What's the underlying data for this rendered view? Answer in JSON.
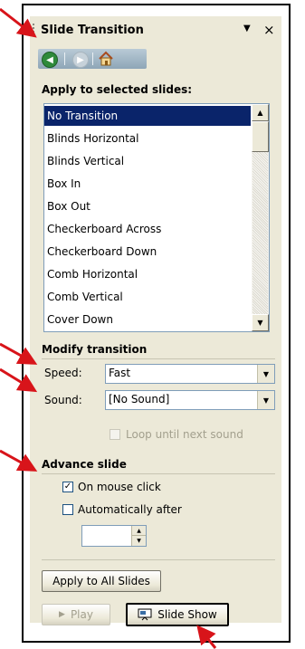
{
  "pane": {
    "title": "Slide Transition",
    "menu_glyph": "▼",
    "close_glyph": "×",
    "nav": {
      "back": "back-arrow-icon",
      "forward": "forward-arrow-icon",
      "home": "home-icon"
    }
  },
  "apply_section": {
    "title": "Apply to selected slides:",
    "selected_index": 0,
    "items": [
      "No Transition",
      "Blinds Horizontal",
      "Blinds Vertical",
      "Box In",
      "Box Out",
      "Checkerboard Across",
      "Checkerboard Down",
      "Comb Horizontal",
      "Comb Vertical",
      "Cover Down"
    ]
  },
  "modify_section": {
    "title": "Modify transition",
    "speed_label": "Speed:",
    "speed_value": "Fast",
    "sound_label": "Sound:",
    "sound_value": "[No Sound]",
    "loop_label": "Loop until next sound",
    "loop_checked": false,
    "loop_enabled": false
  },
  "advance_section": {
    "title": "Advance slide",
    "on_click_label": "On mouse click",
    "on_click_checked": true,
    "auto_label": "Automatically after",
    "auto_checked": false,
    "auto_value": ""
  },
  "buttons": {
    "apply_all": "Apply to All Slides",
    "play": "Play",
    "slideshow": "Slide Show"
  },
  "colors": {
    "pane_bg": "#ece9d8",
    "selection": "#0a246a",
    "annotation_arrow": "#d8141a"
  }
}
